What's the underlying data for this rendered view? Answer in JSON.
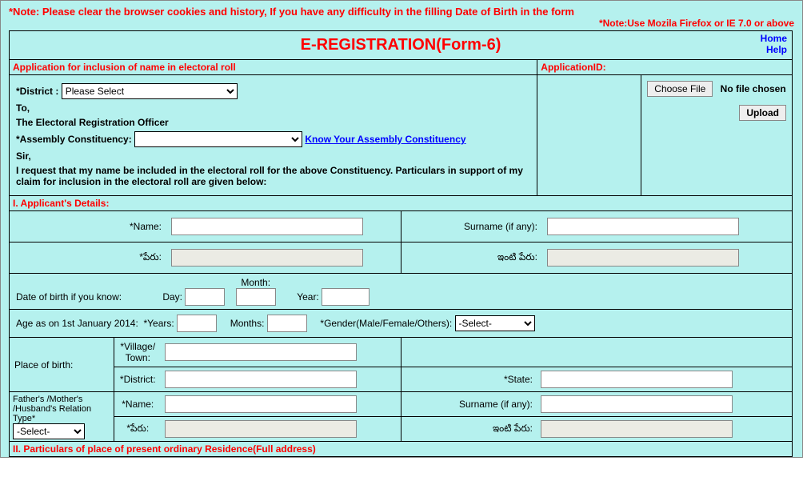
{
  "notes": {
    "note1": "*Note: Please clear the browser cookies and history, If you have any difficulty in the filling Date of Birth in the form",
    "note2": "*Note:Use Mozila Firefox or IE 7.0 or above"
  },
  "header": {
    "title": "E-REGISTRATION(Form-6)",
    "home": "Home",
    "help": "Help"
  },
  "app_header": {
    "left": "Application for inclusion of name in electoral roll",
    "right": "ApplicationID:"
  },
  "district": {
    "label": "*District :",
    "selected": "Please Select"
  },
  "to_line": "To,",
  "officer": "The Electoral Registration Officer",
  "assembly": {
    "label": "*Assembly Constituency:",
    "link": "Know Your Assembly Constituency"
  },
  "sir": "Sir,",
  "request": "I request that my name be included in the electoral roll for the above Constituency. Particulars in support of my claim for inclusion in the electoral roll are given below:",
  "file": {
    "choose": "Choose File",
    "chosen": "No file chosen",
    "upload": "Upload"
  },
  "section1": "I. Applicant's Details:",
  "labels": {
    "name": "*Name:",
    "surname": "Surname (if any):",
    "peru": "*పేరు:",
    "intiperu": "ఇంటి పేరు:",
    "dob": "Date of birth if you know:",
    "day": "Day:",
    "month": "Month:",
    "year": "Year:",
    "age": "Age as on 1st January 2014:",
    "years": "*Years:",
    "months": "Months:",
    "gender": "*Gender(Male/Female/Others):",
    "gender_sel": "-Select-",
    "place": "Place of birth:",
    "village": "*Village/\nTown:",
    "district2": "*District:",
    "state": "*State:",
    "father": "Father's /Mother's /Husband's Relation Type*",
    "father_sel": "-Select-",
    "name2": "*Name:",
    "surname2": "Surname (if any):",
    "peru2": "*పేరు:",
    "intiperu2": "ఇంటి పేరు:"
  },
  "section2": "II. Particulars of place of present ordinary Residence(Full address)"
}
